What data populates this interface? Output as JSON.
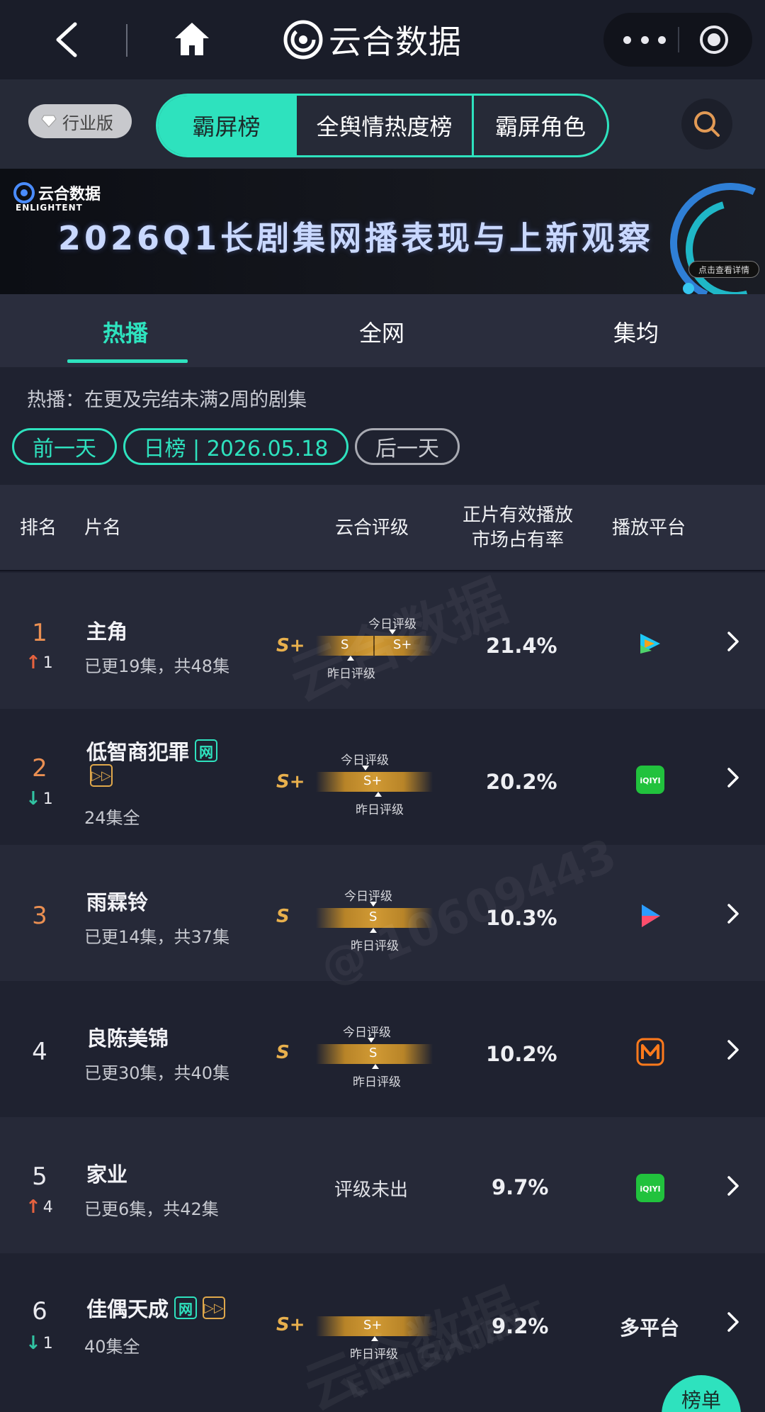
{
  "header": {
    "brand": "云合数据"
  },
  "toolbar": {
    "industry_badge": "行业版",
    "segments": [
      "霸屏榜",
      "全舆情热度榜",
      "霸屏角色"
    ]
  },
  "banner": {
    "logo_text": "云合数据",
    "logo_sub": "ENLIGHTENT",
    "title": "2026Q1长剧集网播表现与上新观察",
    "cta": "点击查看详情"
  },
  "tabs": [
    "热播",
    "全网",
    "集均"
  ],
  "filter": {
    "note": "热播：在更及完结未满2周的剧集",
    "prev": "前一天",
    "current": "日榜 | 2026.05.18",
    "next": "后一天"
  },
  "table": {
    "headers": {
      "rank": "排名",
      "name": "片名",
      "grade": "云合评级",
      "share_l1": "正片有效播放",
      "share_l2": "市场占有率",
      "platform": "播放平台"
    },
    "rows": [
      {
        "rank": "1",
        "change": "1",
        "direction": "up",
        "title": "主角",
        "sub": "已更19集，共48集",
        "grade": "S+",
        "yesterday": "S",
        "today": "S+",
        "share": "21.4%",
        "platform": "tencent-video"
      },
      {
        "rank": "2",
        "change": "1",
        "direction": "down",
        "title": "低智商犯罪",
        "tags": [
          "网"
        ],
        "vip": "▷▷",
        "sub": "24集全",
        "grade": "S+",
        "today": "S+",
        "share": "20.2%",
        "platform": "iqiyi"
      },
      {
        "rank": "3",
        "title": "雨霖铃",
        "sub": "已更14集，共37集",
        "grade": "S",
        "today": "S",
        "share": "10.3%",
        "platform": "youku"
      },
      {
        "rank": "4",
        "title": "良陈美锦",
        "sub": "已更30集，共40集",
        "grade": "S",
        "today": "S",
        "share": "10.2%",
        "platform": "mango-tv"
      },
      {
        "rank": "5",
        "change": "4",
        "direction": "up",
        "title": "家业",
        "sub": "已更6集，共42集",
        "grade_text": "评级未出",
        "share": "9.7%",
        "platform": "iqiyi"
      },
      {
        "rank": "6",
        "change": "1",
        "direction": "down",
        "title": "佳偶天成",
        "tags": [
          "网"
        ],
        "vip": "▷▷",
        "sub": "40集全",
        "grade": "S+",
        "today": "S+",
        "share": "9.2%",
        "platform_text": "多平台"
      }
    ],
    "labels": {
      "today": "今日评级",
      "yesterday": "昨日评级"
    }
  },
  "watermarks": [
    "云合数据",
    "ENLIGHTENT",
    "@ 10609443"
  ],
  "fab": "榜单",
  "colors": {
    "accent": "#2ee2be",
    "gold": "#e8b04d",
    "up": "#e6623f",
    "down": "#31c3a2"
  }
}
